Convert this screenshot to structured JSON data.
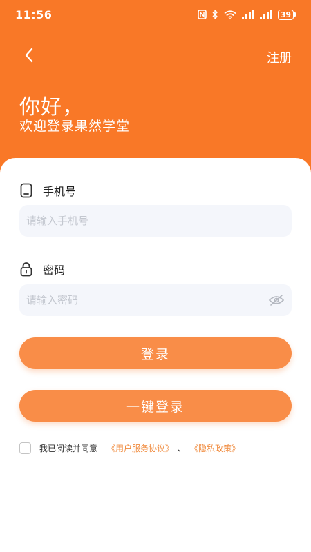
{
  "status_bar": {
    "time": "11:56",
    "battery": "39"
  },
  "header": {
    "back_icon": "chevron-left-icon",
    "register_label": "注册",
    "greeting": "你好，",
    "welcome": "欢迎登录果然学堂"
  },
  "form": {
    "phone": {
      "label": "手机号",
      "icon": "phone-icon",
      "placeholder": "请输入手机号",
      "value": ""
    },
    "password": {
      "label": "密码",
      "icon": "lock-icon",
      "placeholder": "请输入密码",
      "value": "",
      "toggle_icon": "eye-closed-icon"
    },
    "login_label": "登录",
    "one_click_label": "一键登录"
  },
  "agreement": {
    "prefix": "我已阅读并同意",
    "terms_link": "《用户服务协议》",
    "separator": "、",
    "privacy_link": "《隐私政策》",
    "checked": false
  },
  "colors": {
    "brand_orange": "#f97827",
    "button_orange": "#f98d48",
    "link_orange": "#f08a3c",
    "input_bg": "#f4f6fb"
  }
}
